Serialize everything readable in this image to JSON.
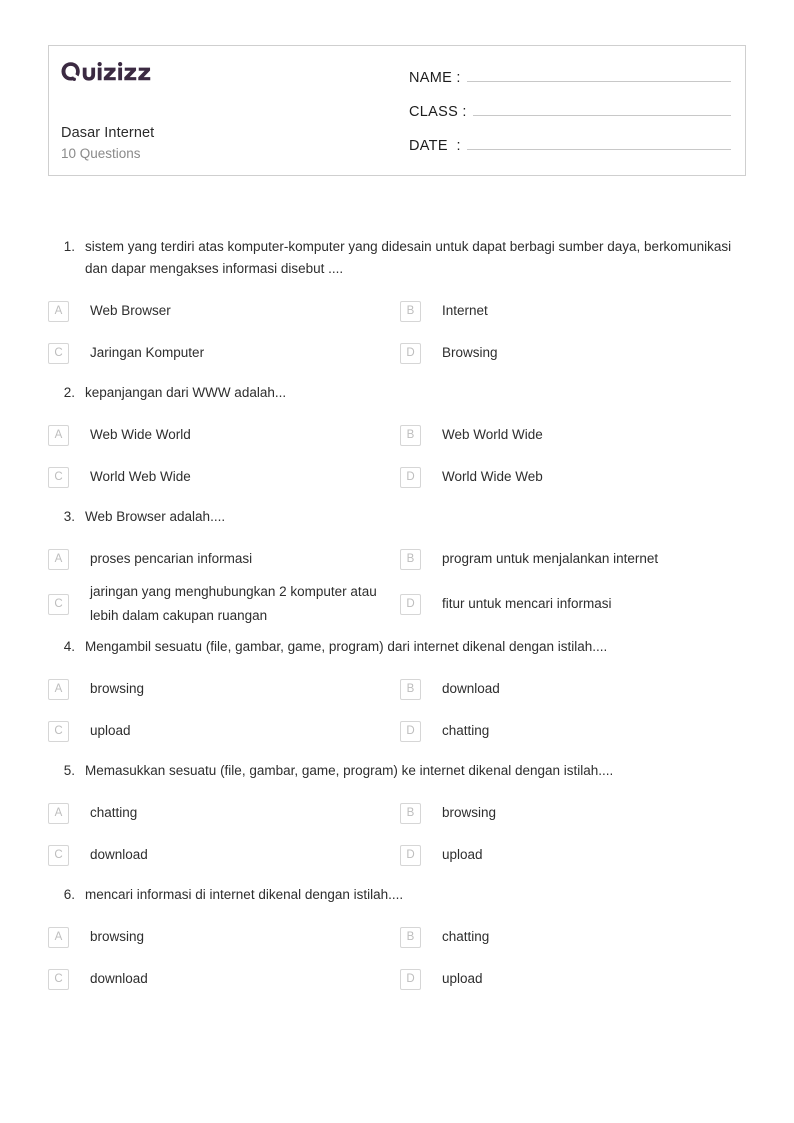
{
  "header": {
    "logo_text": "Quizizz",
    "quiz_title": "Dasar Internet",
    "question_count": "10 Questions",
    "fields": [
      {
        "label": "NAME :",
        "value": ""
      },
      {
        "label": "CLASS :",
        "value": ""
      },
      {
        "label": "DATE  :",
        "value": ""
      }
    ]
  },
  "questions": [
    {
      "number": "1.",
      "text": "sistem yang terdiri atas komputer-komputer yang didesain untuk dapat berbagi sumber daya, berkomunikasi dan dapar mengakses informasi disebut ....",
      "options": [
        {
          "letter": "A",
          "text": "Web Browser"
        },
        {
          "letter": "B",
          "text": "Internet"
        },
        {
          "letter": "C",
          "text": "Jaringan Komputer"
        },
        {
          "letter": "D",
          "text": "Browsing"
        }
      ]
    },
    {
      "number": "2.",
      "text": "kepanjangan dari WWW adalah...",
      "options": [
        {
          "letter": "A",
          "text": "Web Wide World"
        },
        {
          "letter": "B",
          "text": "Web World Wide"
        },
        {
          "letter": "C",
          "text": "World Web Wide"
        },
        {
          "letter": "D",
          "text": "World Wide Web"
        }
      ]
    },
    {
      "number": "3.",
      "text": "Web Browser adalah....",
      "options": [
        {
          "letter": "A",
          "text": "proses pencarian informasi"
        },
        {
          "letter": "B",
          "text": "program untuk menjalankan internet"
        },
        {
          "letter": "C",
          "text": "jaringan yang menghubungkan 2 komputer atau lebih dalam cakupan ruangan"
        },
        {
          "letter": "D",
          "text": "fitur untuk mencari informasi"
        }
      ]
    },
    {
      "number": "4.",
      "text": "Mengambil sesuatu (file, gambar, game, program) dari internet dikenal dengan istilah....",
      "options": [
        {
          "letter": "A",
          "text": "browsing"
        },
        {
          "letter": "B",
          "text": "download"
        },
        {
          "letter": "C",
          "text": "upload"
        },
        {
          "letter": "D",
          "text": "chatting"
        }
      ]
    },
    {
      "number": "5.",
      "text": "Memasukkan sesuatu (file, gambar, game, program) ke internet dikenal dengan istilah....",
      "options": [
        {
          "letter": "A",
          "text": "chatting"
        },
        {
          "letter": "B",
          "text": "browsing"
        },
        {
          "letter": "C",
          "text": "download"
        },
        {
          "letter": "D",
          "text": "upload"
        }
      ]
    },
    {
      "number": "6.",
      "text": "mencari informasi di internet dikenal dengan istilah....",
      "options": [
        {
          "letter": "A",
          "text": "browsing"
        },
        {
          "letter": "B",
          "text": "chatting"
        },
        {
          "letter": "C",
          "text": "download"
        },
        {
          "letter": "D",
          "text": "upload"
        }
      ]
    }
  ],
  "colors": {
    "logo": "#3b2a42",
    "text": "#2e2e2e",
    "muted": "#8a8a8a",
    "border": "#cfcfcf",
    "letter_box_border": "#d6d6d6",
    "letter_box_text": "#bdbdbd"
  }
}
